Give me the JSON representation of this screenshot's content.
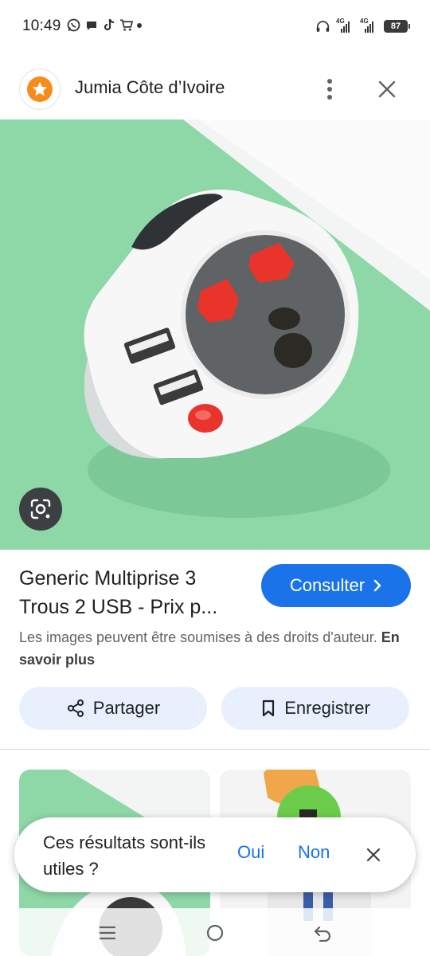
{
  "status_bar": {
    "time": "10:49",
    "battery": "87",
    "network_1": "4G",
    "network_2": "4G"
  },
  "header": {
    "site_name": "Jumia Côte d’Ivoire",
    "more_icon": "more-vert-icon",
    "close_icon": "close-icon"
  },
  "result": {
    "title": "Generic Multiprise 3 Trous 2 USB - Prix p...",
    "consult_label": "Consulter",
    "rights_text": "Les images peuvent être soumises à des droits d'auteur.",
    "learn_more": "En savoir plus",
    "share_label": "Partager",
    "save_label": "Enregistrer"
  },
  "feedback": {
    "question": "Ces résultats sont-ils utiles ?",
    "yes": "Oui",
    "no": "Non"
  },
  "colors": {
    "accent": "#1a73e8",
    "pill_bg": "#e8f0fe",
    "image_bg": "#8ed8a8",
    "brand_orange": "#f68b1e"
  }
}
